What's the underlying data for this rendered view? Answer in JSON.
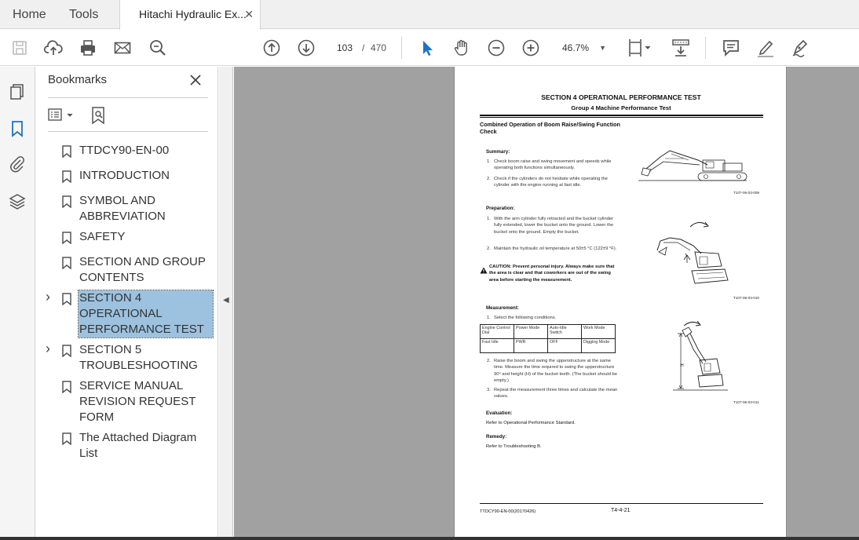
{
  "tabs": {
    "home": "Home",
    "tools": "Tools",
    "document": "Hitachi Hydraulic Ex...",
    "close": "✕"
  },
  "toolbar": {
    "current_page": "103",
    "page_separator": "/",
    "total_pages": "470",
    "zoom": "46.7%"
  },
  "bookmarks": {
    "title": "Bookmarks",
    "items": [
      {
        "label": "TTDCY90-EN-00",
        "expandable": false,
        "selected": false
      },
      {
        "label": "INTRODUCTION",
        "expandable": false,
        "selected": false
      },
      {
        "label": "SYMBOL AND ABBREVIATION",
        "expandable": false,
        "selected": false
      },
      {
        "label": "SAFETY",
        "expandable": false,
        "selected": false
      },
      {
        "label": "SECTION AND GROUP CONTENTS",
        "expandable": false,
        "selected": false
      },
      {
        "label": "SECTION 4 OPERATIONAL PERFORMANCE TEST",
        "expandable": true,
        "selected": true
      },
      {
        "label": "SECTION 5 TROUBLESHOOTING",
        "expandable": true,
        "selected": false
      },
      {
        "label": "SERVICE MANUAL REVISION REQUEST FORM",
        "expandable": false,
        "selected": false
      },
      {
        "label": "The Attached Diagram List",
        "expandable": false,
        "selected": false
      }
    ]
  },
  "page": {
    "section_title": "SECTION 4 OPERATIONAL PERFORMANCE TEST",
    "group_title": "Group 4 Machine Performance Test",
    "heading": "Combined Operation of Boom Raise/Swing Function Check",
    "summary_head": "Summary:",
    "summary_1": "Check boom raise and swing movement and speeds while operating both functions simultaneously.",
    "summary_2": "Check if the cylinders do not hesitate while operating the cylinder with the engine running at fast idle.",
    "prep_head": "Preparation:",
    "prep_1": "With the arm cylinder fully retracted and the bucket cylinder fully extended, lower the bucket onto the ground. Lower the bucket onto the ground. Empty the bucket.",
    "prep_2": "Maintain the hydraulic oil temperature at 50±5 °C (122±9 °F).",
    "caution": "CAUTION:    Prevent personal injury. Always make sure that the area is clear and that coworkers are out of the swing area before starting the measurement.",
    "meas_head": "Measurement:",
    "meas_1": "Select the following conditions.",
    "table": {
      "header": [
        "Engine Control Dial",
        "Power Mode",
        "Auto-Idle Switch",
        "Work Mode"
      ],
      "row": [
        "Fast Idle",
        "PWR",
        "OFF",
        "Digging Mode"
      ]
    },
    "meas_2": "Raise the boom and swing the upperstructure at the same time. Measure the time required to swing the upperstructure 90° and height (H) of the bucket teeth. (The bucket should be empty.)",
    "meas_3": "Repeat the measurement three times and calculate the mean values.",
    "eval_head": "Evaluation:",
    "eval_text": "Refer to Operational Performance Standard.",
    "remedy_head": "Remedy:",
    "remedy_text": "Refer to Troubleshooting B.",
    "fig1": "T107-06-03-009",
    "fig2": "T107-06-03-010",
    "fig3": "T107-06-03-011",
    "fig3_label": "H",
    "footer_left": "TTDCY90-EN-00(20170426)",
    "footer_right": "T4-4-21"
  }
}
